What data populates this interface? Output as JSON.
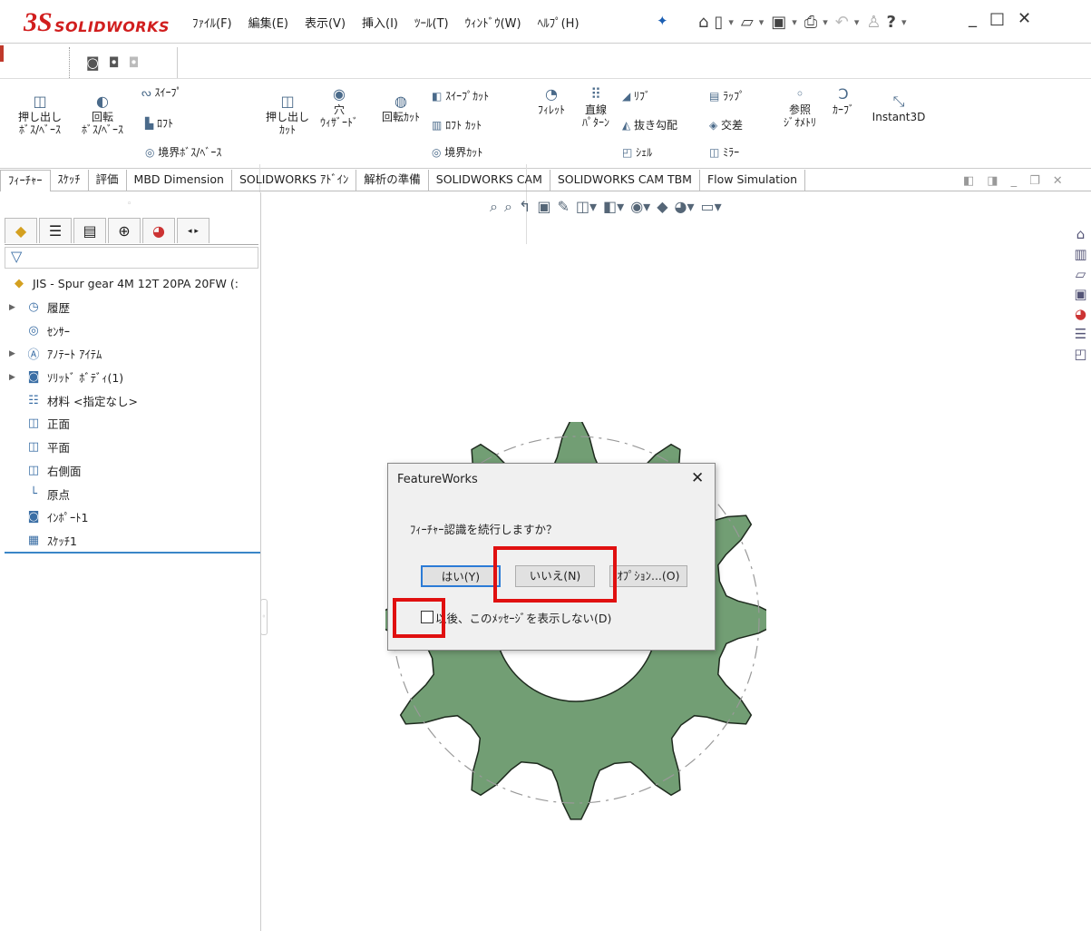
{
  "app": {
    "logo_ds": "3S",
    "logo_sw": "SOLIDWORKS"
  },
  "menu": [
    "ﾌｧｲﾙ(F)",
    "編集(E)",
    "表示(V)",
    "挿入(I)",
    "ﾂｰﾙ(T)",
    "ｳｨﾝﾄﾞｳ(W)",
    "ﾍﾙﾌﾟ(H)"
  ],
  "ribbon": {
    "extrude_boss": "押し出し\nﾎﾞｽ/ﾍﾞｰｽ",
    "revolve_boss": "回転\nﾎﾞｽ/ﾍﾞｰｽ",
    "sweep": "ｽｲｰﾌﾟ",
    "loft": "ﾛﾌﾄ",
    "boundary_boss": "境界ﾎﾞｽ/ﾍﾞｰｽ",
    "extrude_cut": "押し出し\nｶｯﾄ",
    "hole_wizard": "穴\nｳｨｻﾞｰﾄﾞ",
    "revolve_cut": "回転ｶｯﾄ",
    "sweep_cut": "ｽｲｰﾌﾟｶｯﾄ",
    "loft_cut": "ﾛﾌﾄ ｶｯﾄ",
    "boundary_cut": "境界ｶｯﾄ",
    "fillet": "ﾌｨﾚｯﾄ",
    "linear_pattern": "直線\nﾊﾟﾀｰﾝ",
    "rib": "ﾘﾌﾞ",
    "draft": "抜き勾配",
    "shell": "ｼｪﾙ",
    "wrap": "ﾗｯﾌﾟ",
    "intersect": "交差",
    "mirror": "ﾐﾗｰ",
    "ref_geometry": "参照\nｼﾞｵﾒﾄﾘ",
    "curves": "ｶｰﾌﾞ",
    "instant3d": "Instant3D"
  },
  "tabs": [
    "ﾌｨｰﾁｬｰ",
    "ｽｹｯﾁ",
    "評価",
    "MBD Dimension",
    "SOLIDWORKS ｱﾄﾞｲﾝ",
    "解析の準備",
    "SOLIDWORKS CAM",
    "SOLIDWORKS CAM TBM",
    "Flow Simulation"
  ],
  "tree": [
    {
      "label": "JIS - Spur gear 4M 12T 20PA 20FW  (:",
      "expand": false,
      "icon": "part-icon"
    },
    {
      "label": "履歴",
      "expand": true,
      "icon": "history-icon"
    },
    {
      "label": "ｾﾝｻｰ",
      "expand": false,
      "icon": "sensor-icon"
    },
    {
      "label": "ｱﾉﾃｰﾄ ｱｲﾃﾑ",
      "expand": true,
      "icon": "annotation-icon"
    },
    {
      "label": "ｿﾘｯﾄﾞ ﾎﾞﾃﾞｨ(1)",
      "expand": true,
      "icon": "solid-body-icon"
    },
    {
      "label": "材料 <指定なし>",
      "expand": false,
      "icon": "material-icon"
    },
    {
      "label": "正面",
      "expand": false,
      "icon": "plane-icon"
    },
    {
      "label": "平面",
      "expand": false,
      "icon": "plane-icon"
    },
    {
      "label": "右側面",
      "expand": false,
      "icon": "plane-icon"
    },
    {
      "label": "原点",
      "expand": false,
      "icon": "origin-icon"
    },
    {
      "label": "ｲﾝﾎﾟｰﾄ1",
      "expand": false,
      "icon": "import-icon"
    },
    {
      "label": "ｽｹｯﾁ1",
      "expand": false,
      "icon": "sketch-icon"
    }
  ],
  "dialog": {
    "title": "FeatureWorks",
    "close": "✕",
    "message": "ﾌｨｰﾁｬｰ認識を続行しますか？",
    "yes": "はい(Y)",
    "no": "いいえ(N)",
    "options": "ｵﾌﾟｼｮﾝ...(O)",
    "dont_show": "以後、このﾒｯｾｰｼﾞを表示しない(D)"
  },
  "colors": {
    "gear_fill": "#729e74",
    "highlight": "#e01010",
    "accent": "#2b7bd6"
  }
}
